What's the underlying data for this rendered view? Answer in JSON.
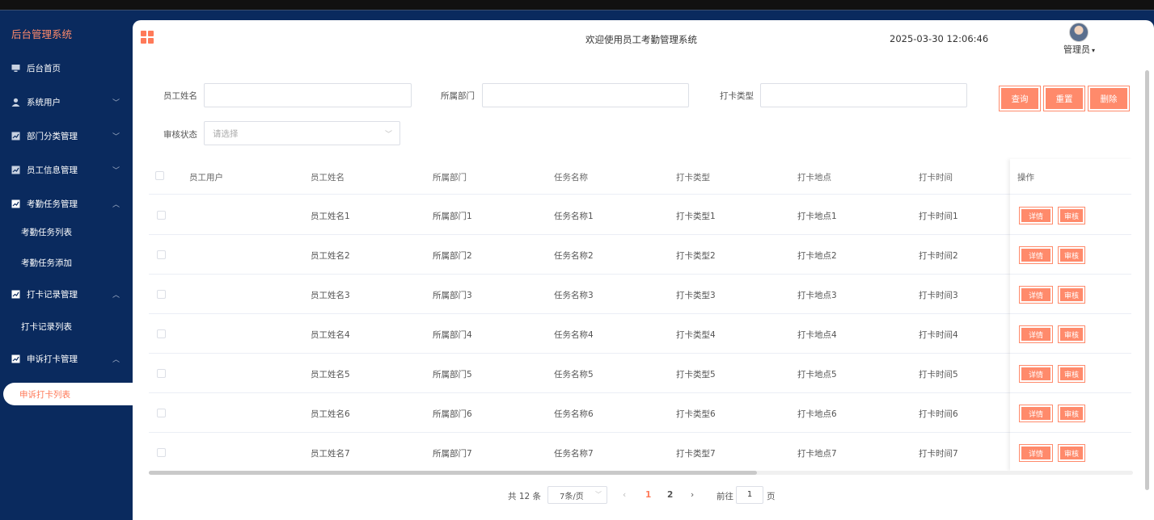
{
  "app": {
    "brand": "后台管理系统"
  },
  "sidebar": {
    "items": [
      {
        "label": "后台首页",
        "icon": "monitor-icon",
        "chevron": ""
      },
      {
        "label": "系统用户",
        "icon": "user-icon",
        "chevron": "﹀"
      },
      {
        "label": "部门分类管理",
        "icon": "chart-icon",
        "chevron": "﹀"
      },
      {
        "label": "员工信息管理",
        "icon": "chart-icon",
        "chevron": "﹀"
      },
      {
        "label": "考勤任务管理",
        "icon": "chart-icon",
        "chevron": "︿"
      },
      {
        "label": "考勤任务列表",
        "sub": true
      },
      {
        "label": "考勤任务添加",
        "sub": true
      },
      {
        "label": "打卡记录管理",
        "icon": "chart-icon",
        "chevron": "︿"
      },
      {
        "label": "打卡记录列表",
        "sub": true
      },
      {
        "label": "申诉打卡管理",
        "icon": "chart-icon",
        "chevron": "︿"
      },
      {
        "label": "申诉打卡列表",
        "sub": true,
        "active": true
      }
    ]
  },
  "header": {
    "welcome": "欢迎使用员工考勤管理系统",
    "datetime": "2025-03-30 12:06:46",
    "user": "管理员",
    "user_caret": "▾"
  },
  "search": {
    "employee_name_label": "员工姓名",
    "employee_name_value": "",
    "department_label": "所属部门",
    "department_value": "",
    "punch_type_label": "打卡类型",
    "punch_type_value": "",
    "review_status_label": "审核状态",
    "review_status_placeholder": "请选择",
    "query_button": "查询",
    "reset_button": "重置",
    "delete_button": "删除"
  },
  "table": {
    "columns": [
      "员工用户",
      "员工姓名",
      "所属部门",
      "任务名称",
      "打卡类型",
      "打卡地点",
      "打卡时间",
      "操作"
    ],
    "rows": [
      [
        "",
        "员工姓名1",
        "所属部门1",
        "任务名称1",
        "打卡类型1",
        "打卡地点1",
        "打卡时间1"
      ],
      [
        "",
        "员工姓名2",
        "所属部门2",
        "任务名称2",
        "打卡类型2",
        "打卡地点2",
        "打卡时间2"
      ],
      [
        "",
        "员工姓名3",
        "所属部门3",
        "任务名称3",
        "打卡类型3",
        "打卡地点3",
        "打卡时间3"
      ],
      [
        "",
        "员工姓名4",
        "所属部门4",
        "任务名称4",
        "打卡类型4",
        "打卡地点4",
        "打卡时间4"
      ],
      [
        "",
        "员工姓名5",
        "所属部门5",
        "任务名称5",
        "打卡类型5",
        "打卡地点5",
        "打卡时间5"
      ],
      [
        "",
        "员工姓名6",
        "所属部门6",
        "任务名称6",
        "打卡类型6",
        "打卡地点6",
        "打卡时间6"
      ],
      [
        "",
        "员工姓名7",
        "所属部门7",
        "任务名称7",
        "打卡类型7",
        "打卡地点7",
        "打卡时间7"
      ]
    ],
    "detail_button": "详情",
    "review_button": "审核"
  },
  "pagination": {
    "total": "共 12 条",
    "page_size": "7条/页",
    "prev": "‹",
    "pages": [
      "1",
      "2"
    ],
    "current_page": "1",
    "next": "›",
    "goto_label": "前往",
    "goto_value": "1",
    "page_unit": "页"
  },
  "colors": {
    "accent": "#ff8a6b",
    "sidebar": "#0a2a5e",
    "active_text": "#ff7a59"
  }
}
